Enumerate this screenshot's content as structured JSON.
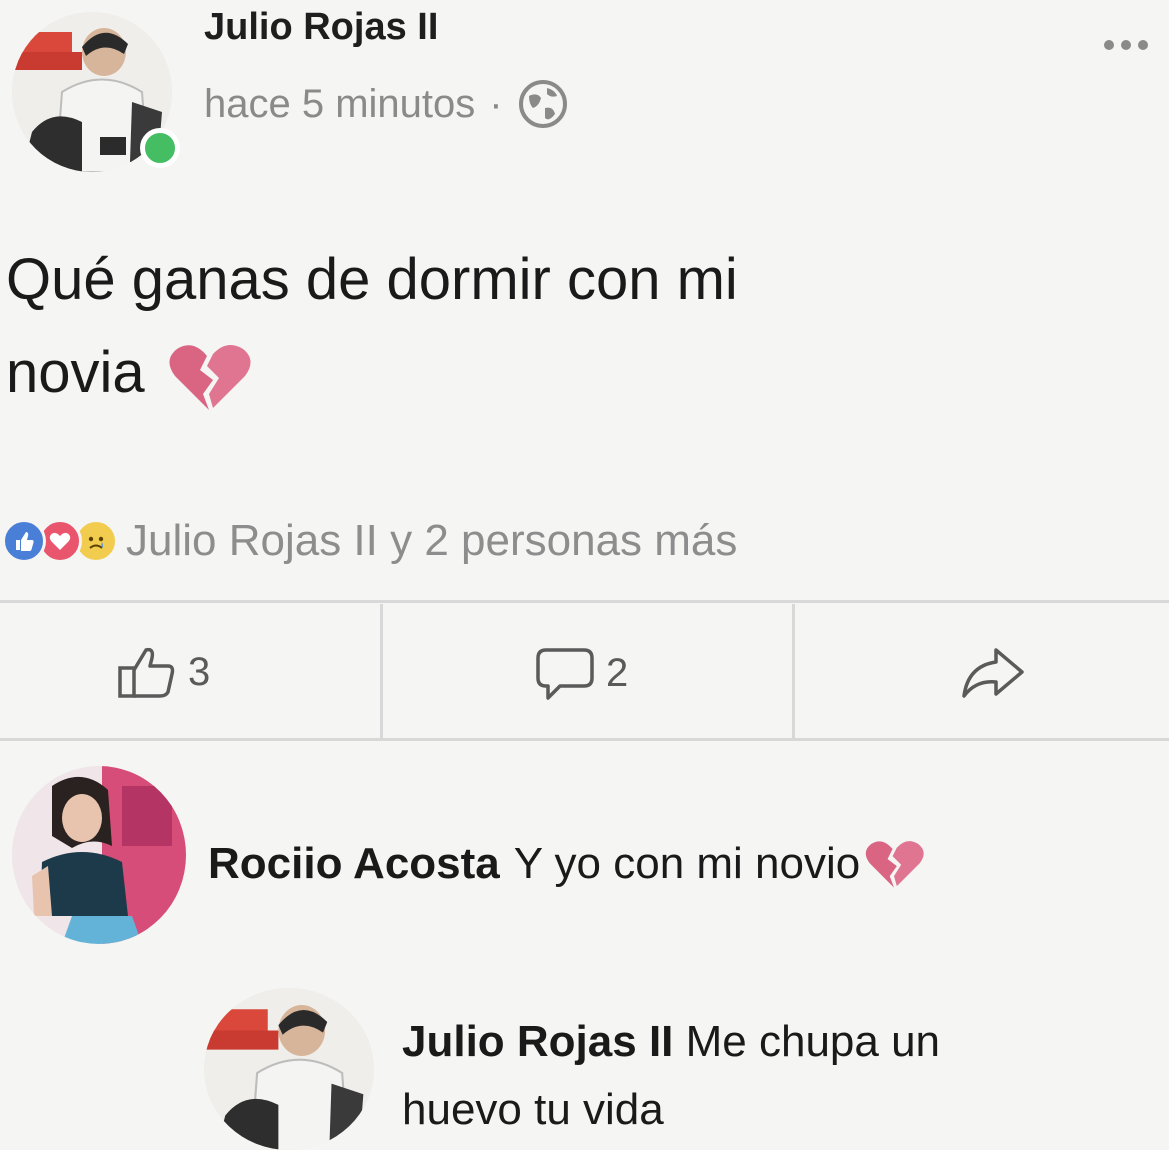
{
  "post": {
    "author": "Julio Rojas II",
    "time": "hace 5 minutos",
    "separator": "·",
    "text_line1": "Qué ganas de dormir con mi",
    "text_line2": "novia",
    "reactions_text": "Julio Rojas II y 2 personas más",
    "like_count": "3",
    "comment_count": "2",
    "accent_color": "#e06a8a",
    "online_color": "#45bd62"
  },
  "comments": [
    {
      "author": "Rociio Acosta",
      "text": "Y yo con mi novio"
    },
    {
      "author": "Julio Rojas II",
      "text_line1": "Me chupa un",
      "text_line2": "huevo tu vida"
    }
  ]
}
